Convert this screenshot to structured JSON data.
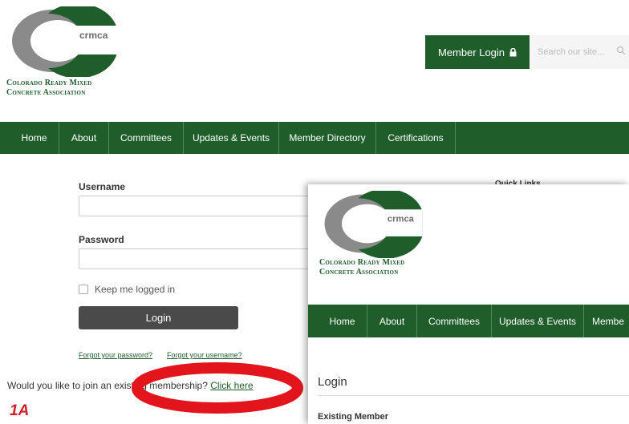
{
  "brand": {
    "abbrev": "crmca",
    "name_line1": "Colorado Ready Mixed",
    "name_line2": "Concrete Association",
    "colors": {
      "green": "#1f5e2a",
      "gray_ring": "#8a8a8a",
      "highlight_red": "#e2151d"
    }
  },
  "header": {
    "member_login_label": "Member Login",
    "lock_icon": "lock-icon",
    "search_placeholder": "Search our site...",
    "search_icon": "search-icon"
  },
  "nav": {
    "items": [
      {
        "label": "Home"
      },
      {
        "label": "About"
      },
      {
        "label": "Committees"
      },
      {
        "label": "Updates & Events"
      },
      {
        "label": "Member Directory"
      },
      {
        "label": "Certifications"
      }
    ]
  },
  "login_form": {
    "username_label": "Username",
    "password_label": "Password",
    "remember_label": "Keep me logged in",
    "login_button": "Login",
    "forgot_password": "Forgot your password?",
    "forgot_username": "Forgot your username?"
  },
  "join": {
    "prompt": "Would you like to join an existing membership? ",
    "link_label": "Click here"
  },
  "quick_links_label": "Quick Links",
  "step_label": "1A",
  "front_page": {
    "nav_items": [
      {
        "label": "Home"
      },
      {
        "label": "About"
      },
      {
        "label": "Committees"
      },
      {
        "label": "Updates & Events"
      },
      {
        "label": "Membe"
      }
    ],
    "login_title": "Login",
    "existing_member": "Existing Member"
  }
}
